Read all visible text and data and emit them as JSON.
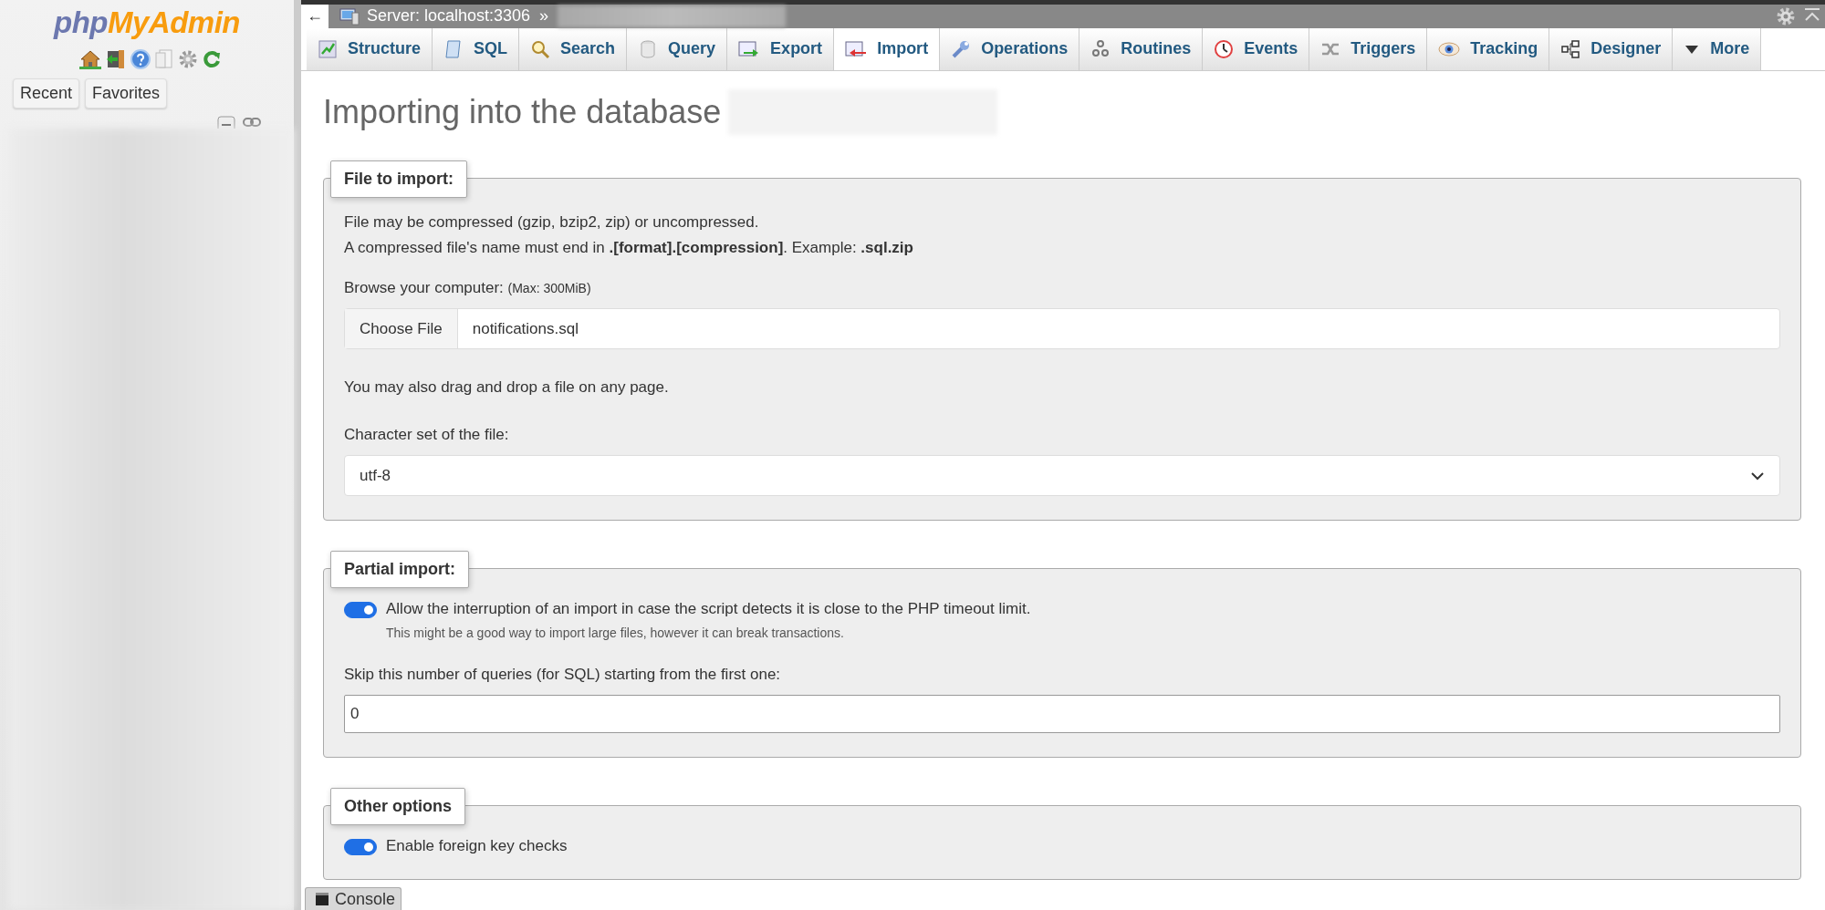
{
  "sidebar": {
    "logo_php": "php",
    "logo_my_admin": "MyAdmin",
    "buttons": [
      "Recent",
      "Favorites"
    ]
  },
  "top_bar": {
    "back": "←",
    "server": "Server: localhost:3306",
    "separator": "»"
  },
  "tabs": [
    {
      "label": "Structure",
      "selected": false
    },
    {
      "label": "SQL",
      "selected": false
    },
    {
      "label": "Search",
      "selected": false
    },
    {
      "label": "Query",
      "selected": false
    },
    {
      "label": "Export",
      "selected": false
    },
    {
      "label": "Import",
      "selected": true
    },
    {
      "label": "Operations",
      "selected": false
    },
    {
      "label": "Routines",
      "selected": false
    },
    {
      "label": "Events",
      "selected": false
    },
    {
      "label": "Triggers",
      "selected": false
    },
    {
      "label": "Tracking",
      "selected": false
    },
    {
      "label": "Designer",
      "selected": false
    },
    {
      "label": "More",
      "selected": false
    }
  ],
  "heading": "Importing into the database",
  "sections": [
    {
      "legend": "File to import:",
      "items": [
        {
          "kind": "text",
          "text": "File may be compressed (gzip, bzip2, zip) or uncompressed."
        },
        {
          "kind": "text",
          "text": "A compressed file's name must end in **.[format].[compression]**. Example: **.sql.zip**"
        },
        {
          "kind": "label",
          "text": "Browse your computer:",
          "note": "(Max: 300MiB)"
        },
        {
          "kind": "file",
          "button": "Choose File",
          "value": "notifications.sql"
        },
        {
          "kind": "label",
          "text": "You may also drag and drop a file on any page."
        },
        {
          "kind": "label",
          "text": "Character set of the file:"
        },
        {
          "kind": "select",
          "value": "utf-8"
        }
      ]
    },
    {
      "legend": "Partial import:",
      "items": [
        {
          "kind": "toggle",
          "on": true,
          "text": "Allow the interruption of an import in case the script detects it is close to the PHP timeout limit.",
          "hint": "This might be a good way to import large files, however it can break transactions."
        },
        {
          "kind": "label",
          "text": "Skip this number of queries (for SQL) starting from the first one:"
        },
        {
          "kind": "input",
          "value": "0"
        }
      ]
    },
    {
      "legend": "Other options",
      "items": [
        {
          "kind": "toggle",
          "on": true,
          "text": "Enable foreign key checks"
        }
      ]
    }
  ],
  "console": "Console"
}
